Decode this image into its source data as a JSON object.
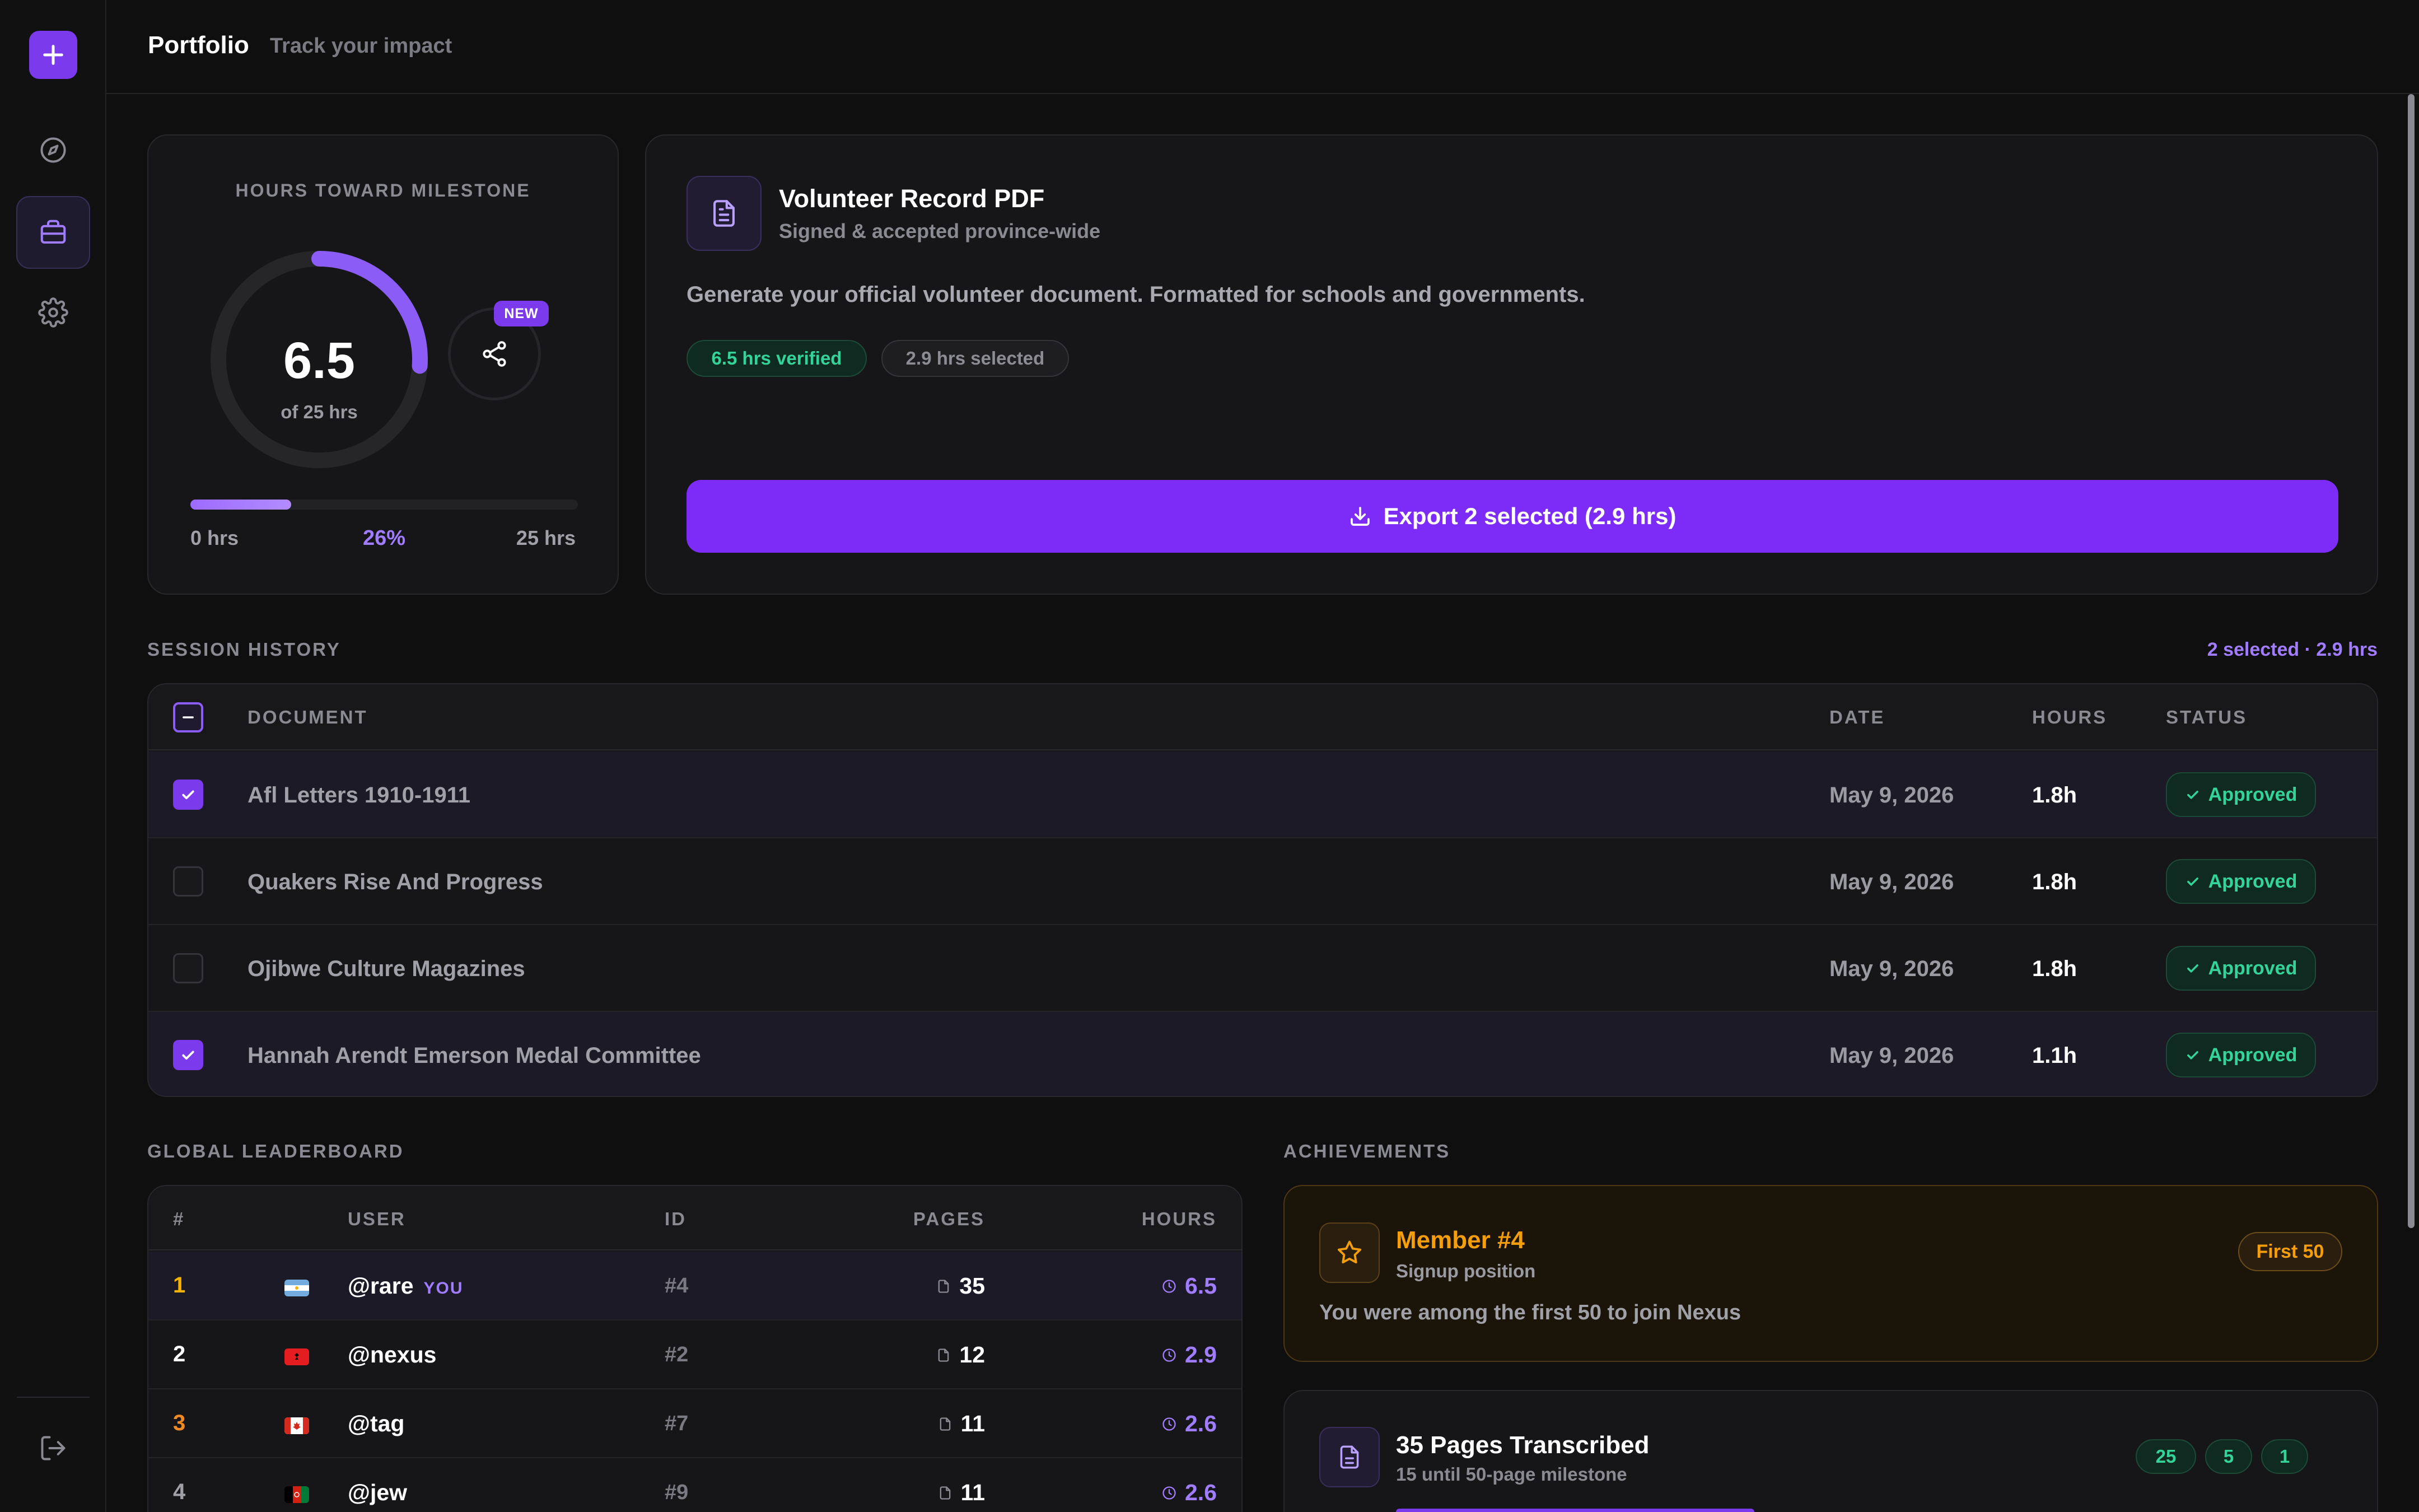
{
  "header": {
    "title": "Portfolio",
    "subtitle": "Track your impact"
  },
  "sidebar": {
    "items": [
      {
        "icon": "compass-icon"
      },
      {
        "icon": "briefcase-icon",
        "active": true
      },
      {
        "icon": "gear-icon"
      }
    ],
    "logout_icon": "logout-icon"
  },
  "milestone": {
    "label": "HOURS TOWARD MILESTONE",
    "value": "6.5",
    "of_label": "of 25 hrs",
    "hours": 6.5,
    "goal": 25,
    "progress_fraction": 0.26,
    "new_badge": "NEW",
    "min_label": "0 hrs",
    "percent_label": "26%",
    "max_label": "25 hrs"
  },
  "pdf": {
    "title": "Volunteer Record PDF",
    "subtitle": "Signed & accepted province-wide",
    "description": "Generate your official volunteer document. Formatted for schools and governments.",
    "chip_verified": "6.5 hrs verified",
    "chip_selected": "2.9 hrs selected",
    "export_label": "Export 2 selected (2.9 hrs)"
  },
  "session": {
    "label": "SESSION HISTORY",
    "selection_info": "2 selected · 2.9 hrs",
    "columns": {
      "document": "DOCUMENT",
      "date": "DATE",
      "hours": "HOURS",
      "status": "STATUS"
    },
    "rows": [
      {
        "document": "Afl Letters 1910-1911",
        "date": "May 9, 2026",
        "hours": "1.8h",
        "status": "Approved",
        "selected": true
      },
      {
        "document": "Quakers Rise And Progress",
        "date": "May 9, 2026",
        "hours": "1.8h",
        "status": "Approved",
        "selected": false
      },
      {
        "document": "Ojibwe Culture Magazines",
        "date": "May 9, 2026",
        "hours": "1.8h",
        "status": "Approved",
        "selected": false
      },
      {
        "document": "Hannah Arendt Emerson Medal Committee",
        "date": "May 9, 2026",
        "hours": "1.1h",
        "status": "Approved",
        "selected": true
      }
    ]
  },
  "leaderboard": {
    "label": "GLOBAL LEADERBOARD",
    "columns": {
      "rank": "#",
      "user": "USER",
      "id": "ID",
      "pages": "PAGES",
      "hours": "HOURS"
    },
    "you_tag": "YOU",
    "rows": [
      {
        "rank": "1",
        "user": "@rare",
        "id": "#4",
        "pages": "35",
        "hours": "6.5",
        "rank_color": "#f5b400",
        "flag": "argentina",
        "me": true
      },
      {
        "rank": "2",
        "user": "@nexus",
        "id": "#2",
        "pages": "12",
        "hours": "2.9",
        "rank_color": "#ffffff",
        "flag": "albania",
        "me": false
      },
      {
        "rank": "3",
        "user": "@tag",
        "id": "#7",
        "pages": "11",
        "hours": "2.6",
        "rank_color": "#f08a24",
        "flag": "canada",
        "me": false
      },
      {
        "rank": "4",
        "user": "@jew",
        "id": "#9",
        "pages": "11",
        "hours": "2.6",
        "rank_color": "#a0a0a8",
        "flag": "afghanistan",
        "me": false
      }
    ]
  },
  "achievements": {
    "label": "ACHIEVEMENTS",
    "member": {
      "title": "Member #4",
      "subtitle": "Signup position",
      "description": "You were among the first 50 to join Nexus",
      "badge": "First 50"
    },
    "pages": {
      "title": "35 Pages Transcribed",
      "subtitle": "15 until 50-page milestone",
      "chips": [
        "25",
        "5",
        "1"
      ]
    }
  },
  "colors": {
    "accent": "#7c3aed",
    "success": "#34d399",
    "warning": "#f59e0b",
    "background": "#0f0f10"
  }
}
